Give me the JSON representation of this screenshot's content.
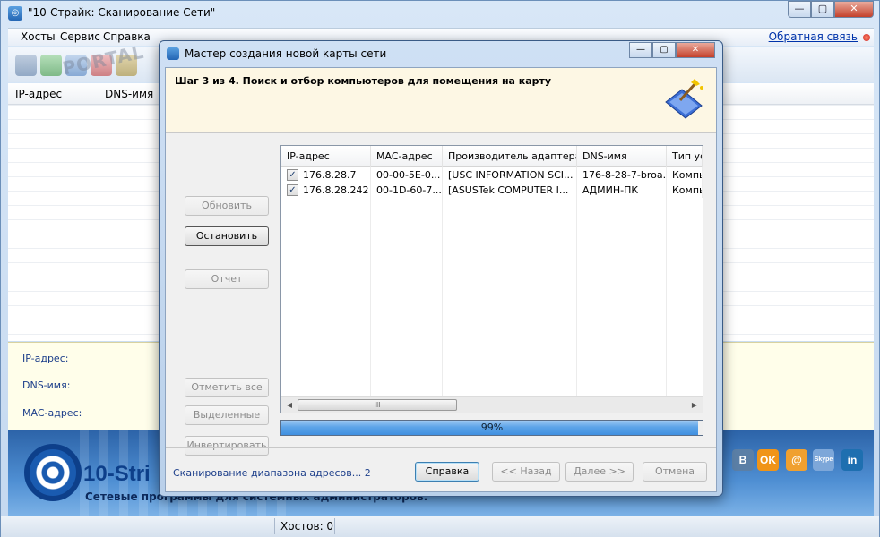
{
  "main": {
    "title": "\"10-Страйк: Сканирование Сети\"",
    "menu": [
      "Хосты",
      "Сервис",
      "Справка"
    ],
    "feedback": "Обратная связь",
    "watermark": "PORTAL",
    "columns": [
      "IP-адрес",
      "DNS-имя"
    ],
    "details": {
      "ip_label": "IP-адрес:",
      "dns_label": "DNS-имя:",
      "mac_label": "MAC-адрес:"
    },
    "banner": {
      "logo": "10-Stri",
      "slogan": "Сетевые программы для системных администраторов."
    },
    "social": [
      "B",
      "OK",
      "@",
      "Skype",
      "in"
    ],
    "status": "Хостов: 0"
  },
  "dialog": {
    "title": "Мастер создания новой карты сети",
    "step": "Шаг 3 из 4. Поиск и отбор компьютеров для помещения на карту",
    "buttons": {
      "refresh": "Обновить",
      "stop": "Остановить",
      "report": "Отчет",
      "select_all": "Отметить все",
      "selected": "Выделенные",
      "invert": "Инвертировать"
    },
    "columns": [
      "IP-адрес",
      "MAC-адрес",
      "Производитель адаптера",
      "DNS-имя",
      "Тип ус"
    ],
    "rows": [
      {
        "checked": true,
        "ip": "176.8.28.7",
        "mac": "00-00-5E-0...",
        "vendor": "[USC INFORMATION SCI...",
        "dns": "176-8-28-7-broa...",
        "type": "Компь"
      },
      {
        "checked": true,
        "ip": "176.8.28.242",
        "mac": "00-1D-60-7...",
        "vendor": "[ASUSTek COMPUTER I...",
        "dns": "АДМИН-ПК",
        "type": "Компь"
      }
    ],
    "progress": {
      "value": 0.99,
      "label": "99%"
    },
    "status": "Сканирование диапазона адресов... 2",
    "footer": {
      "help": "Справка",
      "back": "<< Назад",
      "next": "Далее >>",
      "cancel": "Отмена"
    }
  },
  "colors": {
    "accent": "#3f8fe0",
    "link": "#0033aa",
    "close": "#c4412b"
  }
}
